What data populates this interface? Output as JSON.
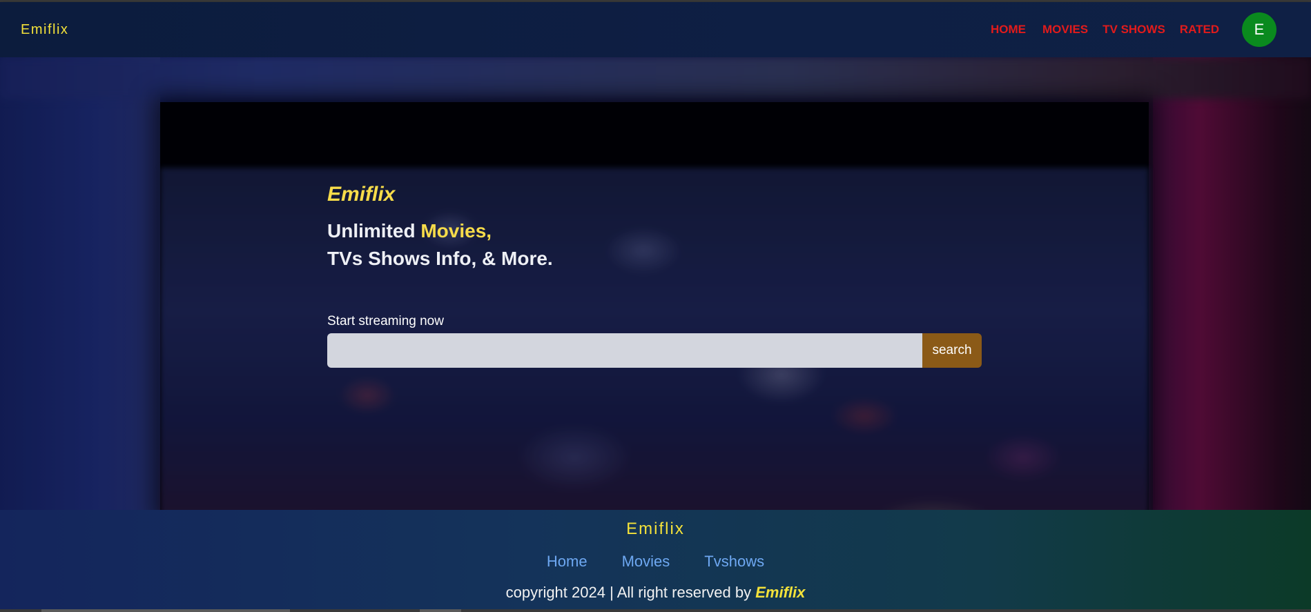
{
  "navbar": {
    "brand": "Emiflix",
    "links": [
      "HOME",
      "MOVIES",
      "TV SHOWS",
      "RATED"
    ],
    "avatar_initial": "E"
  },
  "hero": {
    "brand": "Emiflix",
    "headline_part1": "Unlimited ",
    "headline_accent": "Movies,",
    "headline_line2": "TVs Shows Info, & More.",
    "stream_label": "Start streaming now",
    "search_value": "",
    "search_button": "search"
  },
  "footer": {
    "brand": "Emiflix",
    "links": [
      "Home",
      "Movies",
      "Tvshows"
    ],
    "copyright_prefix": "copyright 2024 | All right reserved by ",
    "copyright_brand": "Emiflix"
  },
  "colors": {
    "nav_bg": "#0e1f44",
    "brand_yellow": "#f4e23a",
    "nav_link_red": "#e21b1b",
    "avatar_green": "#0a8a1e",
    "search_button": "#8b5a17",
    "footer_link_blue": "#6ea8f2"
  }
}
